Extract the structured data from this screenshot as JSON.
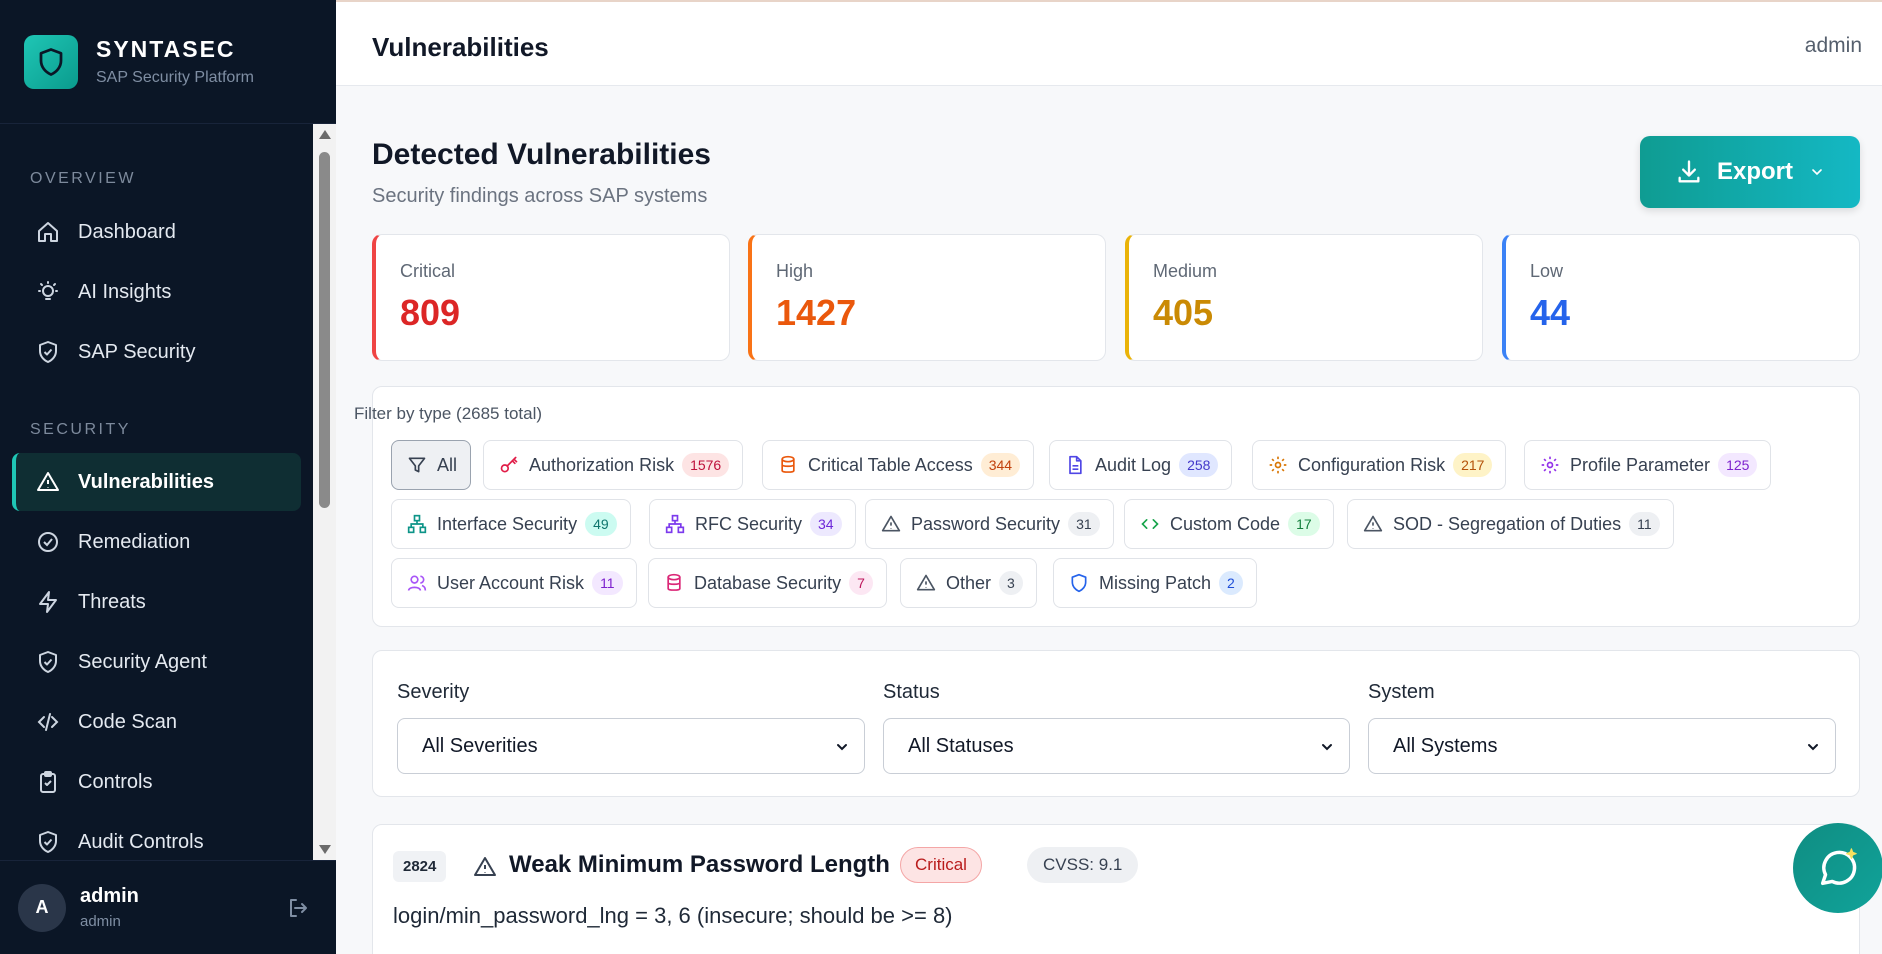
{
  "brand": {
    "name": "SYNTASEC",
    "subtitle": "SAP Security Platform"
  },
  "sidebar": {
    "sections": [
      {
        "label": "OVERVIEW"
      },
      {
        "label": "SECURITY"
      }
    ],
    "items": [
      {
        "label": "Dashboard",
        "icon": "home-icon"
      },
      {
        "label": "AI Insights",
        "icon": "lightbulb-icon"
      },
      {
        "label": "SAP Security",
        "icon": "shield-check-icon"
      },
      {
        "label": "Vulnerabilities",
        "icon": "warning-triangle-icon",
        "active": true
      },
      {
        "label": "Remediation",
        "icon": "check-circle-icon"
      },
      {
        "label": "Threats",
        "icon": "lightning-icon"
      },
      {
        "label": "Security Agent",
        "icon": "shield-check-icon"
      },
      {
        "label": "Code Scan",
        "icon": "code-icon"
      },
      {
        "label": "Controls",
        "icon": "clipboard-check-icon"
      },
      {
        "label": "Audit Controls",
        "icon": "shield-check-icon"
      }
    ],
    "user": {
      "initial": "A",
      "name": "admin",
      "role": "admin"
    }
  },
  "topbar": {
    "title": "Vulnerabilities",
    "user": "admin"
  },
  "page": {
    "title": "Detected Vulnerabilities",
    "subtitle": "Security findings across SAP systems",
    "export_label": "Export"
  },
  "stats": [
    {
      "label": "Critical",
      "value": "809",
      "color": "#dc2626"
    },
    {
      "label": "High",
      "value": "1427",
      "color": "#ea580c"
    },
    {
      "label": "Medium",
      "value": "405",
      "color": "#ca8a04"
    },
    {
      "label": "Low",
      "value": "44",
      "color": "#2563eb"
    }
  ],
  "filter": {
    "title": "Filter by type (2685 total)",
    "chips": [
      {
        "label": "All",
        "count": "",
        "active": true
      },
      {
        "label": "Authorization Risk",
        "count": "1576"
      },
      {
        "label": "Critical Table Access",
        "count": "344"
      },
      {
        "label": "Audit Log",
        "count": "258"
      },
      {
        "label": "Configuration Risk",
        "count": "217"
      },
      {
        "label": "Profile Parameter",
        "count": "125"
      },
      {
        "label": "Interface Security",
        "count": "49"
      },
      {
        "label": "RFC Security",
        "count": "34"
      },
      {
        "label": "Password Security",
        "count": "31"
      },
      {
        "label": "Custom Code",
        "count": "17"
      },
      {
        "label": "SOD - Segregation of Duties",
        "count": "11"
      },
      {
        "label": "User Account Risk",
        "count": "11"
      },
      {
        "label": "Database Security",
        "count": "7"
      },
      {
        "label": "Other",
        "count": "3"
      },
      {
        "label": "Missing Patch",
        "count": "2"
      }
    ]
  },
  "selects": [
    {
      "label": "Severity",
      "value": "All Severities"
    },
    {
      "label": "Status",
      "value": "All Statuses"
    },
    {
      "label": "System",
      "value": "All Systems"
    }
  ],
  "vulnerability": {
    "id": "2824",
    "title": "Weak Minimum Password Length",
    "severity": "Critical",
    "cvss": "CVSS: 9.1",
    "description": "login/min_password_lng = 3, 6 (insecure; should be >= 8)"
  },
  "colors": {
    "accent": "#1fc6b5",
    "sidebar_bg": "#0b1626"
  }
}
